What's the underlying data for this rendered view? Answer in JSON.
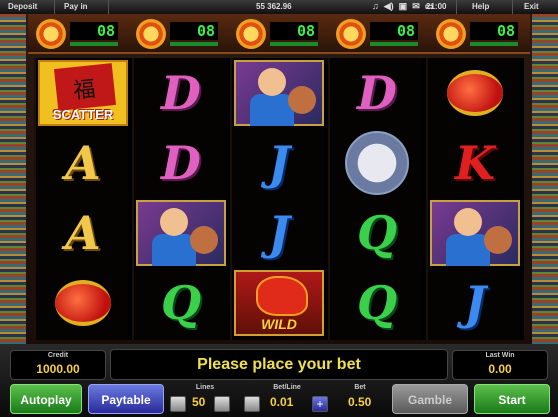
{
  "topbar": {
    "deposit": "Deposit",
    "payin": "Pay in",
    "balance": "55 362.96",
    "time": "21:00",
    "help": "Help",
    "exit": "Exit",
    "icons": [
      "music-icon",
      "volume-icon",
      "fullscreen-icon",
      "message-icon",
      "battery-icon"
    ]
  },
  "lines": {
    "indicators": [
      "08",
      "08",
      "08",
      "08",
      "08"
    ]
  },
  "reels": [
    [
      "SCATTER",
      "A",
      "A",
      "lantern"
    ],
    [
      "D",
      "D",
      "man-with-ball",
      "Q"
    ],
    [
      "man-with-ball",
      "J",
      "J",
      "WILD"
    ],
    [
      "D",
      "lion",
      "Q",
      "Q"
    ],
    [
      "lantern",
      "K",
      "man-with-ball",
      "J"
    ]
  ],
  "bottom": {
    "credit_label": "Credit",
    "credit_value": "1000.00",
    "message": "Please place your bet",
    "lastwin_label": "Last Win",
    "lastwin_value": "0.00",
    "autoplay": "Autoplay",
    "paytable": "Paytable",
    "lines_label": "Lines",
    "lines_value": "50",
    "betline_label": "Bet/Line",
    "betline_value": "0.01",
    "bet_label": "Bet",
    "bet_value": "0.50",
    "gamble": "Gamble",
    "start": "Start"
  }
}
